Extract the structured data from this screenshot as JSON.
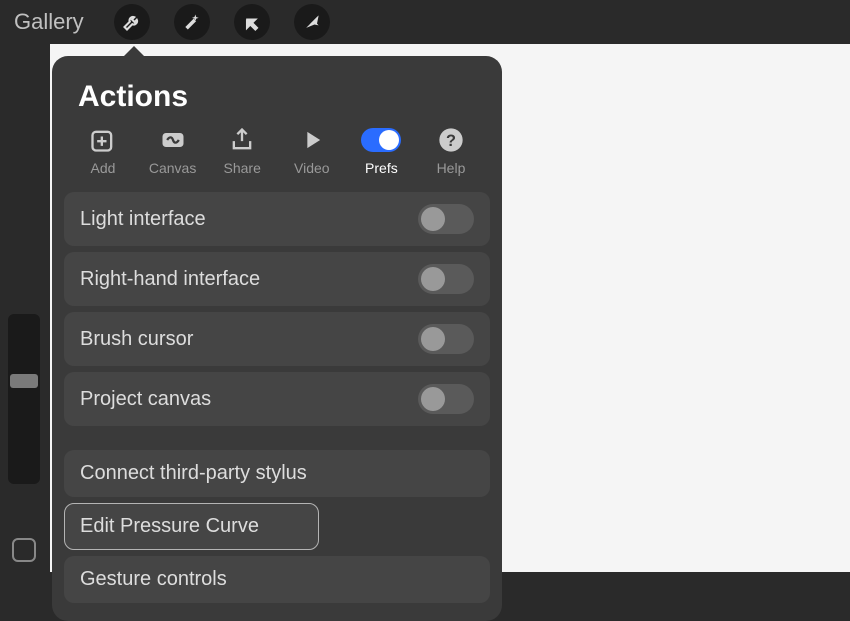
{
  "topbar": {
    "gallery": "Gallery"
  },
  "popover": {
    "title": "Actions",
    "tabs": [
      {
        "label": "Add"
      },
      {
        "label": "Canvas"
      },
      {
        "label": "Share"
      },
      {
        "label": "Video"
      },
      {
        "label": "Prefs"
      },
      {
        "label": "Help"
      }
    ],
    "prefs": {
      "light_interface": "Light interface",
      "right_hand": "Right-hand interface",
      "brush_cursor": "Brush cursor",
      "project_canvas": "Project canvas",
      "connect_stylus": "Connect third-party stylus",
      "edit_pressure": "Edit Pressure Curve",
      "gesture_controls": "Gesture controls"
    }
  }
}
